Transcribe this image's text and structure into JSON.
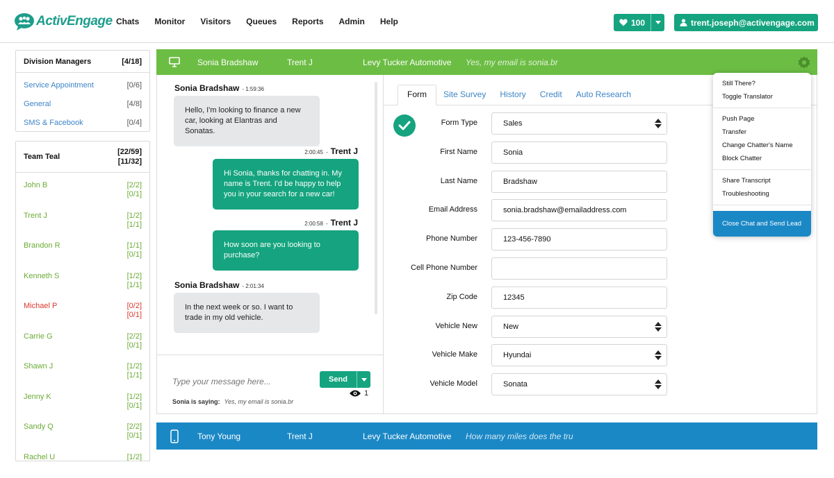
{
  "brand": {
    "name": "ActivEngage",
    "accent": "#15a47f",
    "green_bar": "#6cbd44",
    "blue_bar": "#1b88c6"
  },
  "nav": {
    "items": [
      "Chats",
      "Monitor",
      "Visitors",
      "Queues",
      "Reports",
      "Admin",
      "Help"
    ]
  },
  "header_right": {
    "heart_count": "100",
    "user_email": "trent.joseph@activengage.com"
  },
  "division": {
    "title": "Division Managers",
    "count": "[4/18]",
    "items": [
      {
        "label": "Service Appointment",
        "count": "[0/6]"
      },
      {
        "label": "General",
        "count": "[4/8]"
      },
      {
        "label": "SMS & Facebook",
        "count": "[0/4]"
      }
    ]
  },
  "team": {
    "title": "Team Teal",
    "count_a": "[22/59]",
    "count_b": "[11/32]",
    "members": [
      {
        "name": "John B",
        "c1": "[2/2]",
        "c2": "[0/1]",
        "color": "#6aab34"
      },
      {
        "name": "Trent J",
        "c1": "[1/2]",
        "c2": "[1/1]",
        "color": "#6aab34"
      },
      {
        "name": "Brandon R",
        "c1": "[1/1]",
        "c2": "[0/1]",
        "color": "#6aab34"
      },
      {
        "name": "Kenneth S",
        "c1": "[1/2]",
        "c2": "[1/1]",
        "color": "#6aab34"
      },
      {
        "name": "Michael P",
        "c1": "[0/2]",
        "c2": "[0/1]",
        "color": "#d9372c"
      },
      {
        "name": "Carrie G",
        "c1": "[2/2]",
        "c2": "[0/1]",
        "color": "#6aab34"
      },
      {
        "name": "Shawn J",
        "c1": "[1/2]",
        "c2": "[1/1]",
        "color": "#6aab34"
      },
      {
        "name": "Jenny K",
        "c1": "[1/2]",
        "c2": "[0/1]",
        "color": "#6aab34"
      },
      {
        "name": "Sandy Q",
        "c1": "[2/2]",
        "c2": "[0/1]",
        "color": "#6aab34"
      },
      {
        "name": "Rachel U",
        "c1": "[1/2]",
        "c2": "",
        "color": "#6aab34"
      }
    ]
  },
  "active_chat": {
    "visitor": "Sonia Bradshaw",
    "agent": "Trent J",
    "dealer": "Levy Tucker Automotive",
    "preview": "Yes, my email is sonia.br"
  },
  "messages": [
    {
      "sender": "Sonia Bradshaw",
      "time": "1:59:36",
      "text": "Hello, I'm looking to finance a new car, looking at Elantras and Sonatas.",
      "dir": "in"
    },
    {
      "sender": "Trent J",
      "time": "2:00:45",
      "text": "Hi Sonia, thanks for chatting in. My name is Trent. I'd be happy to help you in your search for a new car!",
      "dir": "out"
    },
    {
      "sender": "Trent J",
      "time": "2:00:58",
      "text": "How soon are you looking to purchase?",
      "dir": "out"
    },
    {
      "sender": "Sonia Bradshaw",
      "time": "2:01:34",
      "text": "In the next week or so. I want to trade in my old vehicle.",
      "dir": "in"
    }
  ],
  "composer": {
    "placeholder": "Type your message here...",
    "send_label": "Send",
    "viewers": "1",
    "typing_label": "Sonia is saying:",
    "typing_text": "Yes, my email is sonia.br"
  },
  "tabs": [
    "Form",
    "Site Survey",
    "History",
    "Credit",
    "Auto Research"
  ],
  "form": [
    {
      "label": "Form Type",
      "value": "Sales",
      "select": true
    },
    {
      "label": "First Name",
      "value": "Sonia",
      "select": false
    },
    {
      "label": "Last Name",
      "value": "Bradshaw",
      "select": false
    },
    {
      "label": "Email Address",
      "value": "sonia.bradshaw@emailaddress.com",
      "select": false
    },
    {
      "label": "Phone Number",
      "value": "123-456-7890",
      "select": false
    },
    {
      "label": "Cell Phone Number",
      "value": "",
      "select": false
    },
    {
      "label": "Zip Code",
      "value": "12345",
      "select": false
    },
    {
      "label": "Vehicle New",
      "value": "New",
      "select": true
    },
    {
      "label": "Vehicle Make",
      "value": "Hyundai",
      "select": true
    },
    {
      "label": "Vehicle Model",
      "value": "Sonata",
      "select": true
    }
  ],
  "menu": {
    "groups": [
      [
        "Still There?",
        "Toggle Translator"
      ],
      [
        "Push Page",
        "Transfer",
        "Change Chatter's Name",
        "Block Chatter"
      ],
      [
        "Share Transcript",
        "Troubleshooting"
      ]
    ],
    "cta": "Close Chat and Send Lead"
  },
  "queued_chat": {
    "visitor": "Tony Young",
    "agent": "Trent J",
    "dealer": "Levy Tucker Automotive",
    "preview": "How many miles does the tru"
  }
}
